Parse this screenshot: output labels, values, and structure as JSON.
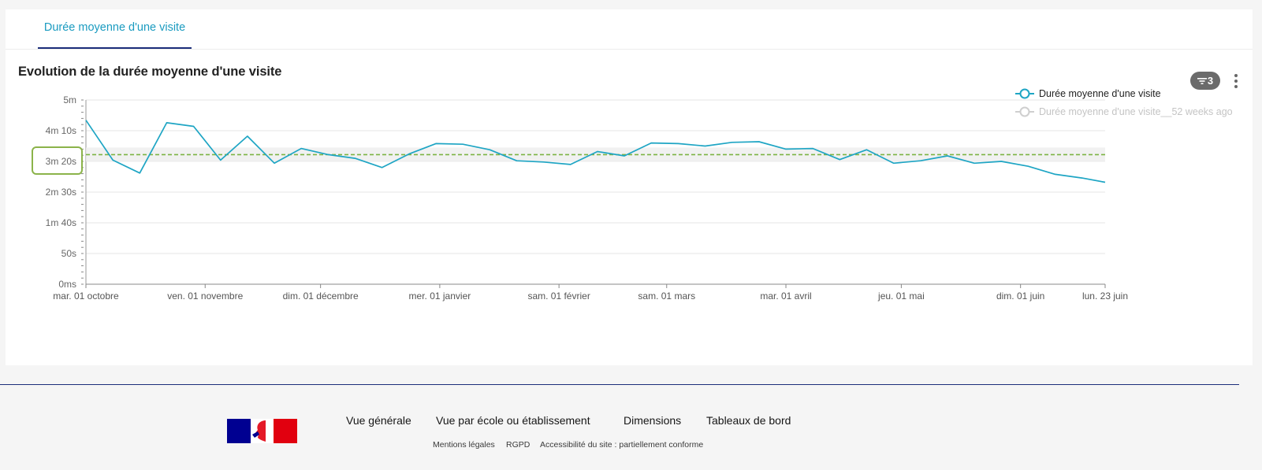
{
  "tabs": [
    {
      "label": "Durée moyenne d'une visite",
      "active": true
    }
  ],
  "chart_title": "Evolution de la durée moyenne d'une visite",
  "filter_badge": {
    "count": "3",
    "icon": "filter-icon"
  },
  "menu_icon": "kebab-menu-icon",
  "chart_data": {
    "type": "line",
    "title": "Evolution de la durée moyenne d'une visite",
    "y_unit": "seconds",
    "ylim": [
      0,
      300
    ],
    "y_ticks": [
      {
        "value": 0,
        "label": "0ms"
      },
      {
        "value": 50,
        "label": "50s"
      },
      {
        "value": 100,
        "label": "1m 40s"
      },
      {
        "value": 150,
        "label": "2m 30s"
      },
      {
        "value": 200,
        "label": "3m 20s"
      },
      {
        "value": 250,
        "label": "4m 10s"
      },
      {
        "value": 300,
        "label": "5m"
      }
    ],
    "highlighted_y_tick": "3m 20s",
    "xlim": [
      "2024-10-01",
      "2025-06-23"
    ],
    "x_ticks": [
      {
        "date": "2024-10-01",
        "label": "mar. 01 octobre"
      },
      {
        "date": "2024-11-01",
        "label": "ven. 01 novembre"
      },
      {
        "date": "2024-12-01",
        "label": "dim. 01 décembre"
      },
      {
        "date": "2025-01-01",
        "label": "mer. 01 janvier"
      },
      {
        "date": "2025-02-01",
        "label": "sam. 01 février"
      },
      {
        "date": "2025-03-01",
        "label": "sam. 01 mars"
      },
      {
        "date": "2025-04-01",
        "label": "mar. 01 avril"
      },
      {
        "date": "2025-05-01",
        "label": "jeu. 01 mai"
      },
      {
        "date": "2025-06-01",
        "label": "dim. 01 juin"
      },
      {
        "date": "2025-06-23",
        "label": "lun. 23 juin"
      }
    ],
    "reference_line": {
      "value": 211,
      "style": "dashed",
      "color": "#7cb342"
    },
    "series": [
      {
        "name": "Durée moyenne d'une visite",
        "color": "#1ea5c4",
        "visible": true,
        "points": [
          [
            "2024-10-01",
            267
          ],
          [
            "2024-10-08",
            202
          ],
          [
            "2024-10-15",
            181
          ],
          [
            "2024-10-22",
            263
          ],
          [
            "2024-10-29",
            257
          ],
          [
            "2024-11-05",
            202
          ],
          [
            "2024-11-12",
            241
          ],
          [
            "2024-11-19",
            197
          ],
          [
            "2024-11-26",
            221
          ],
          [
            "2024-12-03",
            211
          ],
          [
            "2024-12-10",
            205
          ],
          [
            "2024-12-17",
            190
          ],
          [
            "2024-12-24",
            212
          ],
          [
            "2024-12-31",
            229
          ],
          [
            "2025-01-07",
            228
          ],
          [
            "2025-01-14",
            219
          ],
          [
            "2025-01-21",
            201
          ],
          [
            "2025-01-28",
            199
          ],
          [
            "2025-02-04",
            195
          ],
          [
            "2025-02-11",
            216
          ],
          [
            "2025-02-18",
            209
          ],
          [
            "2025-02-25",
            230
          ],
          [
            "2025-03-04",
            229
          ],
          [
            "2025-03-11",
            225
          ],
          [
            "2025-03-18",
            231
          ],
          [
            "2025-03-25",
            232
          ],
          [
            "2025-04-01",
            220
          ],
          [
            "2025-04-08",
            221
          ],
          [
            "2025-04-15",
            203
          ],
          [
            "2025-04-22",
            219
          ],
          [
            "2025-04-29",
            197
          ],
          [
            "2025-05-06",
            201
          ],
          [
            "2025-05-13",
            209
          ],
          [
            "2025-05-20",
            197
          ],
          [
            "2025-05-27",
            200
          ],
          [
            "2025-06-03",
            192
          ],
          [
            "2025-06-10",
            179
          ],
          [
            "2025-06-17",
            173
          ],
          [
            "2025-06-23",
            166
          ]
        ]
      },
      {
        "name": "Durée moyenne d'une visite__52 weeks ago",
        "color": "#cccccc",
        "visible": false
      }
    ],
    "legend": {
      "position": "top-right"
    }
  },
  "footer": {
    "logo": "republique-francaise-logo",
    "flag_colors": [
      "#000091",
      "#ffffff",
      "#e1000f"
    ],
    "nav": [
      "Vue générale",
      "Vue par école ou établissement",
      "Dimensions",
      "Tableaux de bord"
    ],
    "links": [
      "Mentions légales",
      "RGPD",
      "Accessibilité du site : partiellement conforme"
    ]
  }
}
